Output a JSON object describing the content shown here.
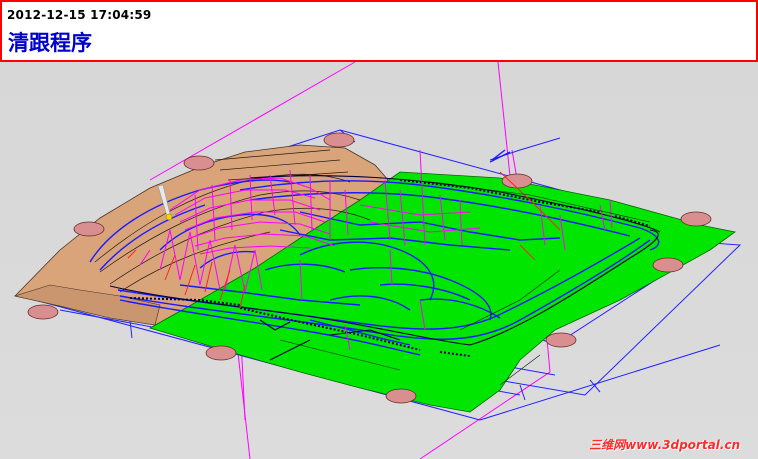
{
  "header": {
    "timestamp": "2012-12-15 17:04:59",
    "program_name": "清跟程序"
  },
  "watermark": {
    "text": "三维网www.3dportal.cn"
  },
  "colors": {
    "header_border": "#ff0000",
    "program_name": "#0000cc",
    "finished_surface": "#00e600",
    "unfinished_surface": "#d9a47a",
    "toolpath_blue": "#1a1aff",
    "toolpath_magenta": "#ff00ff",
    "clamp_pad": "#d98f8f",
    "watermark": "#ff2a2a"
  },
  "icons": {
    "tool": "cutter-tool-icon"
  }
}
